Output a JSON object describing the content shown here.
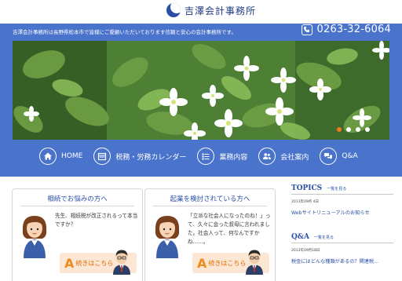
{
  "header": {
    "logo_text": "吉澤会計事務所",
    "tagline": "吉澤会計事務所は長野県松本市で皆様にご愛顧いただいております信頼と安心の会計事務所です。",
    "phone": "0263-32-6064"
  },
  "hero": {
    "slides": 4,
    "active_slide": 1
  },
  "nav": {
    "items": [
      {
        "label": "HOME",
        "icon": "home-icon"
      },
      {
        "label": "税務・労務カレンダー",
        "icon": "calendar-icon"
      },
      {
        "label": "業務内容",
        "icon": "list-icon"
      },
      {
        "label": "会社案内",
        "icon": "people-icon"
      },
      {
        "label": "Q&A",
        "icon": "chat-icon"
      }
    ]
  },
  "cards": [
    {
      "title": "相続でお悩みの方へ",
      "text": "先生、相続税が改正されるって本当ですか？",
      "continue_label": "続きはこちら"
    },
    {
      "title": "起業を検討されている方へ",
      "text": "「立派な社会人になったのね！」って、久々に会った叔母に言われました。社会人って、何なんですかね……。",
      "continue_label": "続きはこちら"
    }
  ],
  "sidebar": {
    "topics": {
      "title": "TOPICS",
      "more": "一覧を見る",
      "date": "2013年09月 4日",
      "link": "Webサイトリニューアルのお知らせ"
    },
    "qa": {
      "title": "Q&A",
      "more": "一覧を見る",
      "date": "2013年09月18日",
      "link": "税金にはどんな種類があるの？関連税..."
    }
  },
  "colors": {
    "brand_blue": "#4a73cc",
    "accent_orange": "#f08a1c"
  }
}
